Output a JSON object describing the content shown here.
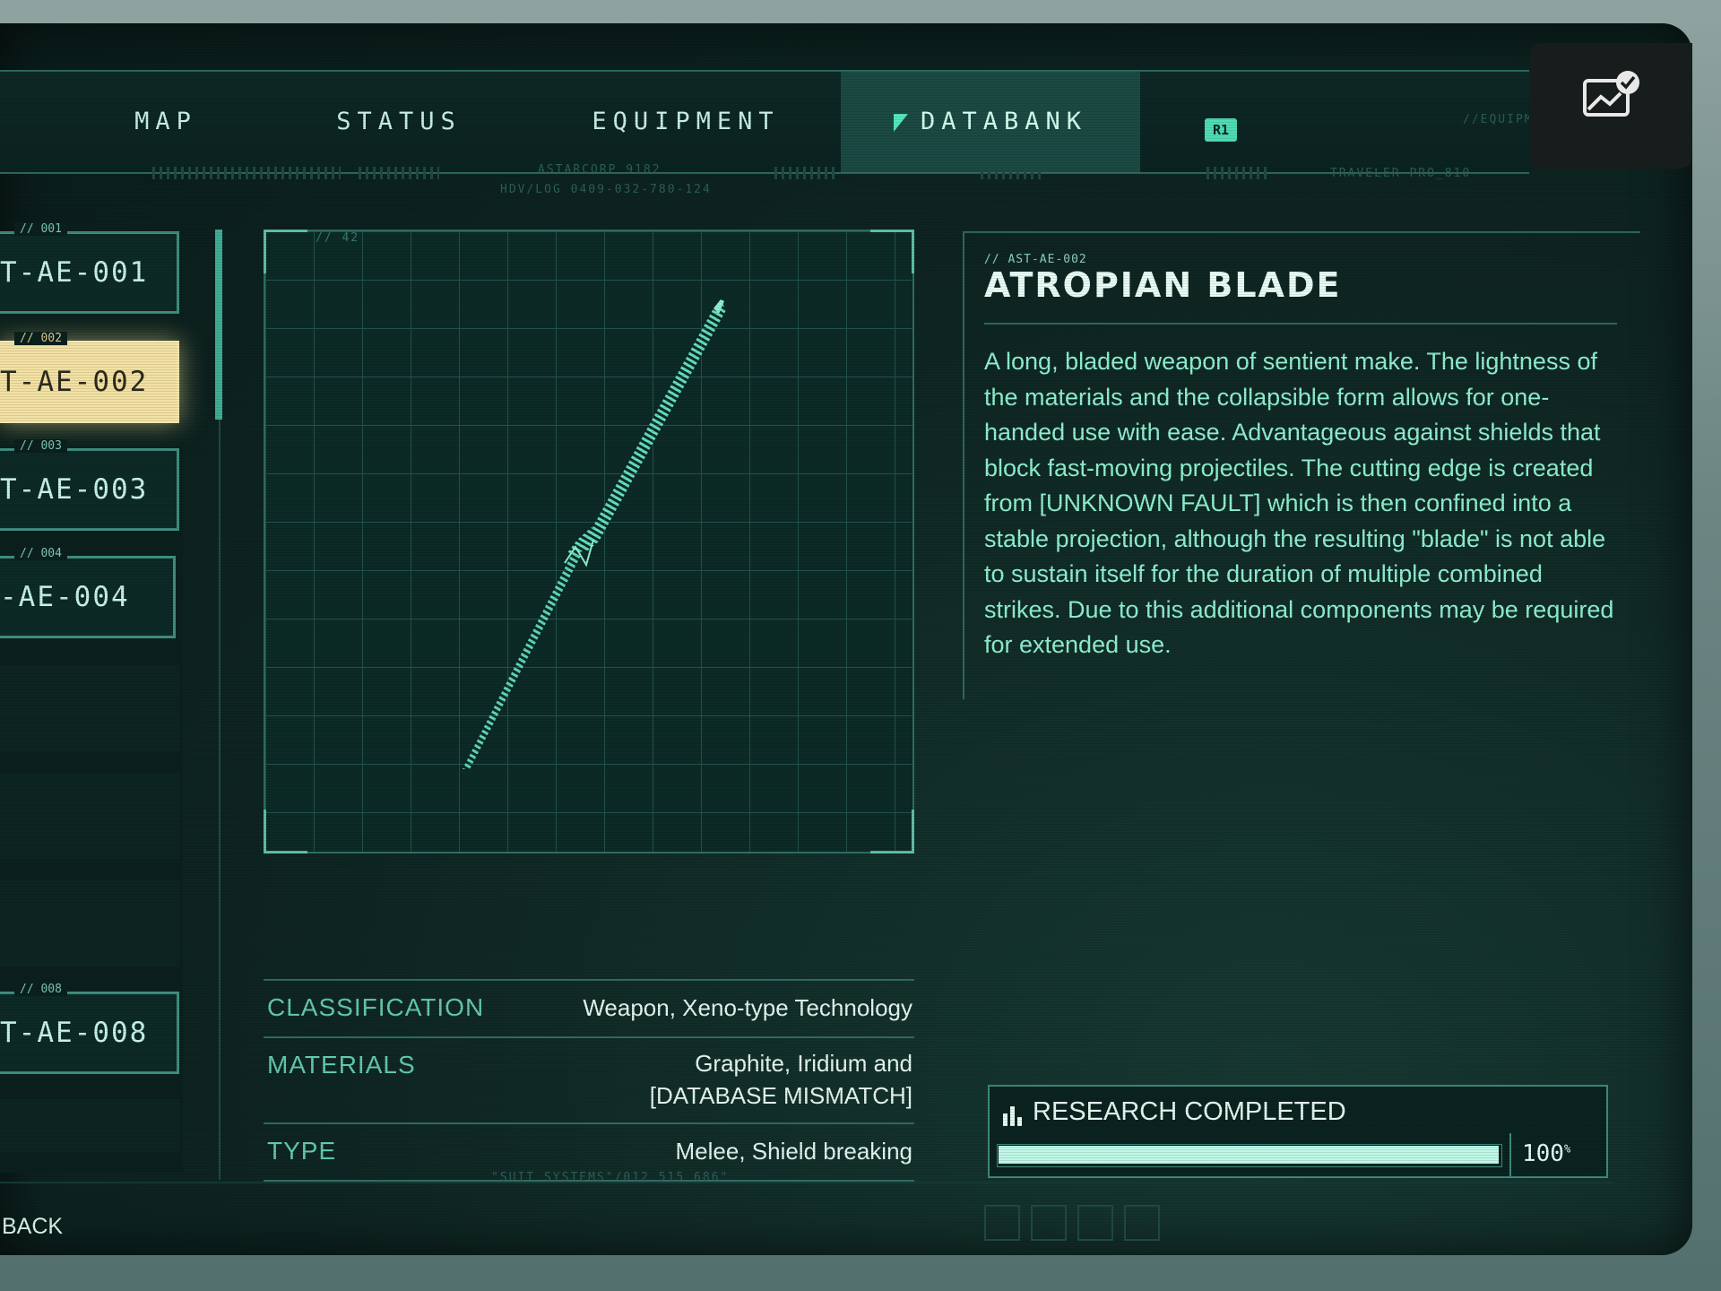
{
  "nav": {
    "tabs": [
      {
        "label": "MAP",
        "active": false
      },
      {
        "label": "STATUS",
        "active": false
      },
      {
        "label": "EQUIPMENT",
        "active": false
      },
      {
        "label": "DATABANK",
        "active": true
      }
    ],
    "next_button": "R1"
  },
  "header_tiny": {
    "left_code": "ASTARCORP 9182",
    "left_sub": "HDV/LOG 0409-032-780-124",
    "right_code": "TRAVELER-PRO_810",
    "far_right": "//EQUIPM"
  },
  "list": {
    "items": [
      {
        "tag": "// 001",
        "label": "T-AE-001",
        "selected": false
      },
      {
        "tag": "// 002",
        "label": "T-AE-002",
        "selected": true
      },
      {
        "tag": "// 003",
        "label": "T-AE-003",
        "selected": false
      },
      {
        "tag": "// 004",
        "label": "-AE-004",
        "selected": false
      },
      {
        "tag": "// 008",
        "label": "T-AE-008",
        "selected": false
      }
    ]
  },
  "blueprint": {
    "label": "// 42"
  },
  "entry": {
    "code": "// AST-AE-002",
    "title": "ATROPIAN BLADE",
    "description": "A long, bladed weapon of sentient make. The lightness of the materials and the collapsible form allows for one-handed use with ease. Advantageous against shields that block fast-moving projectiles. The cutting edge is created from [UNKNOWN FAULT] which is then confined into a stable projection, although the resulting \"blade\" is not able to sustain itself for the duration of multiple combined strikes. Due to this additional components may be required for extended use."
  },
  "stats": [
    {
      "key": "CLASSIFICATION",
      "value": "Weapon, Xeno-type Technology"
    },
    {
      "key": "MATERIALS",
      "value": "Graphite, Iridium and [DATABASE MISMATCH]"
    },
    {
      "key": "TYPE",
      "value": "Melee, Shield breaking"
    }
  ],
  "research": {
    "label": "RESEARCH COMPLETED",
    "percent_value": "100",
    "percent_unit": "%",
    "progress": 1.0
  },
  "footer": {
    "back_label": "BACK",
    "center_code": "\"SUIT SYSTEMS\"/012 515 686\""
  },
  "colors": {
    "accent": "#55e7bd",
    "selected_item": "#f2e1a3",
    "panel_bg": "#0e2522"
  },
  "icons": {
    "notification": "screenshot-saved-icon",
    "research": "bar-chart-icon",
    "active_tab": "triangle-flag-icon"
  }
}
